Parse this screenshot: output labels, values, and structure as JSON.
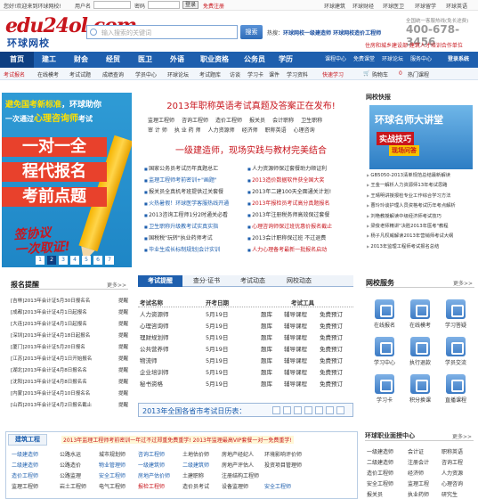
{
  "topbar": {
    "welcome": "您好!欢迎来到环球网校!",
    "username_label": "用户名",
    "password_label": "密码",
    "login": "登录",
    "register": "免费注册",
    "links": [
      "环球建筑",
      "环球财经",
      "环球医卫",
      "环球留学",
      "环球英语"
    ]
  },
  "header": {
    "logo_main": "edu24ol.com",
    "logo_sub": "环球网校",
    "search_placeholder": "输入搜索的关键词",
    "search_button": "搜索",
    "hot_label": "热搜：",
    "hot_terms": "环球网校一级建造师  环球网校造价工程师",
    "phone_label": "全国统一客服热线(免长途费)",
    "phone": "400-678-3456",
    "links": "住房和城乡建设部   建筑人才培训合作单位"
  },
  "nav": {
    "home": "首页",
    "items": [
      "建工",
      "财会",
      "经贸",
      "医卫",
      "外语",
      "职业资格",
      "公务员",
      "学历"
    ],
    "right": [
      "课程中心",
      "免费课堂",
      "环球论坛",
      "服务中心"
    ],
    "login_label": "登录系统"
  },
  "subnav": {
    "items": [
      "考试报名",
      "在线模考",
      "考试试题",
      "成绩查询",
      "学员中心",
      "环球论坛",
      "考试题库",
      "访谈",
      "学习卡",
      "课件",
      "学习资料"
    ],
    "special": "快速学习",
    "cart": "购物车",
    "cart_count": "0",
    "hot_courses": "热门课程"
  },
  "banner": {
    "line1_pre": "避免国",
    "line1_hl": "考新标准",
    "line1_post": "，环球助你",
    "line2_pre": "一次通过",
    "line2_hl": "心理咨询师",
    "line2_post": "考试",
    "big1": "一对一全",
    "big2": "程代报名",
    "big3": "考前点题",
    "sign1": "签协议",
    "sign2": "一次取证!",
    "pages": [
      "1",
      "2",
      "3",
      "4",
      "5",
      "6",
      "7"
    ]
  },
  "reminders": {
    "title": "报名提醒",
    "more": "更多>>",
    "rows": [
      {
        "text": "[吉林]2013年会计证5月30日报名名",
        "tag": "提醒"
      },
      {
        "text": "[成都]2013年会计证4月1日起报名",
        "tag": "提醒"
      },
      {
        "text": "[大连]2013年会计证4月1日起报名",
        "tag": "提醒"
      },
      {
        "text": "[深圳]2013年会计证4月18日起报名",
        "tag": "提醒"
      },
      {
        "text": "[厦门]2013年会计证5月20日报名",
        "tag": "提醒"
      },
      {
        "text": "[江苏]2013年会计证4月1日开始报名",
        "tag": "提醒"
      },
      {
        "text": "[湖北]2013年会计证4月8日报名名",
        "tag": "提醒"
      },
      {
        "text": "[沈阳]2013年会计证4月8日报名名",
        "tag": "提醒"
      },
      {
        "text": "[内蒙]2013年会计证4月10日报名名",
        "tag": "提醒"
      },
      {
        "text": "[山西]2013年会计证4月2日报名截止",
        "tag": "提醒"
      }
    ]
  },
  "center": {
    "headline": "2013年职称英语考试真题及答案正在发布!",
    "grid": [
      [
        "监理工程师",
        "咨询工程师",
        "造价工程师",
        "报关员",
        "会计职称",
        "卫生职称"
      ],
      [
        "审 计 师",
        "执 业 药 师",
        "人力资源师",
        "经济师",
        "职称英语",
        "心理咨询"
      ]
    ],
    "headline2": "一级建造师，现场实践与教材完美结合",
    "left_list": [
      {
        "t": "国家公务员考试历年真题总汇",
        "c": ""
      },
      {
        "t": "监理工程师考前密训+\"画题\"",
        "c": "blue"
      },
      {
        "t": "报关员全真机考班提供过关套餐",
        "c": ""
      },
      {
        "t": "火热暑假！环球医学客服热线开通",
        "c": "blue"
      },
      {
        "t": "2013咨询工程师1分2时通关必看",
        "c": ""
      },
      {
        "t": "卫生职称升级教考试实真实指",
        "c": "blue"
      },
      {
        "t": "国税税\"玩转\"执业药师考试",
        "c": ""
      },
      {
        "t": "毕业生成长标制规划|会计实训",
        "c": "blue"
      }
    ],
    "right_list": [
      {
        "t": "人力资源师保过套餐助力顺证利",
        "c": ""
      },
      {
        "t": "2013造价数据软件获全国大奖",
        "c": "red"
      },
      {
        "t": "2013年二建100天全面通关计划!",
        "c": ""
      },
      {
        "t": "2013年报检员考试高分真题报名",
        "c": "red"
      },
      {
        "t": "2013年注册税务师高效保过套餐",
        "c": ""
      },
      {
        "t": "心理咨询师保过班优惠价报名截止",
        "c": "red"
      },
      {
        "t": "2013会计职称保过班 不过退费",
        "c": ""
      },
      {
        "t": "人力心理备考最新一批报名启动",
        "c": "red"
      }
    ]
  },
  "tabs": {
    "items": [
      "考试提醒",
      "查分·证书",
      "考试动态",
      "网校动态"
    ]
  },
  "exam_table": {
    "headers": [
      "考试名称",
      "开考日期",
      "考试工具"
    ],
    "rows": [
      {
        "name": "人力资源师",
        "date": "5月19日",
        "t1": "题库",
        "t2": "辅导课程",
        "t3": "免费预订"
      },
      {
        "name": "心理咨询师",
        "date": "5月19日",
        "t1": "题库",
        "t2": "辅导课程",
        "t3": "免费预订"
      },
      {
        "name": "理财规划师",
        "date": "5月19日",
        "t1": "题库",
        "t2": "辅导课程",
        "t3": "免费预订"
      },
      {
        "name": "公共营养师",
        "date": "5月19日",
        "t1": "题库",
        "t2": "辅导课程",
        "t3": "免费预订"
      },
      {
        "name": "物流师",
        "date": "5月19日",
        "t1": "题库",
        "t2": "辅导课程",
        "t3": "免费预订"
      },
      {
        "name": "企业培训师",
        "date": "5月19日",
        "t1": "题库",
        "t2": "辅导课程",
        "t3": "免费预订"
      },
      {
        "name": "秘书资格",
        "date": "5月19日",
        "t1": "题库",
        "t2": "辅导课程",
        "t3": "免费预订"
      }
    ],
    "calendar": "2013年全国各省市考试日历表："
  },
  "right_tv": {
    "title": "网校快报",
    "img_t1": "环球名师大讲堂",
    "img_t2": "实战技巧",
    "img_t3": "现场问答",
    "list": [
      "GB5050-2013清单规范总结最新解读",
      "王金一解析人力资源师13年考试思路",
      "王晴明讲授报检专业工作综合学习方法",
      "曹玲玲谈护理人员资格考试历年考点解析",
      "刘艳教授解读中级经济师考试技巧",
      "梁俊老师精讲\"决胜2013年医考\"教程",
      "杨子凡权威解读2013年营销师考试大纲",
      "2013年监理工程师考试报名总结"
    ]
  },
  "services": {
    "title": "网校服务",
    "more": "更多>>",
    "items": [
      "在线报名",
      "在线模考",
      "学习答疑",
      "学习中心",
      "执行退款",
      "学员交流",
      "学习卡",
      "积分换课",
      "直播课程"
    ]
  },
  "bottom_left": {
    "category": "建筑工程",
    "promo": "2013年监理工程师考前密训一年过不过郑重免费重学!  2013年监理最高VIP套餐一对一免费重学!",
    "rows": [
      [
        {
          "t": "一级建造师",
          "c": "blue"
        },
        {
          "t": "公路水运",
          "c": ""
        },
        {
          "t": "城市规划师",
          "c": ""
        },
        {
          "t": "咨询工程师",
          "c": "blue"
        },
        {
          "t": "土地估价师",
          "c": ""
        },
        {
          "t": "房地产经纪人",
          "c": ""
        },
        {
          "t": "环境影响评价师",
          "c": ""
        }
      ],
      [
        {
          "t": "二级建造师",
          "c": "blue"
        },
        {
          "t": "公路造价",
          "c": ""
        },
        {
          "t": "物业管理师",
          "c": "blue"
        },
        {
          "t": "一级建筑师",
          "c": "blue"
        },
        {
          "t": "二级建筑师",
          "c": "blue"
        },
        {
          "t": "房地产评估人",
          "c": ""
        },
        {
          "t": "投资项目管理师",
          "c": ""
        }
      ],
      [
        {
          "t": "造价工程师",
          "c": "blue"
        },
        {
          "t": "公路监理",
          "c": ""
        },
        {
          "t": "安全工程师",
          "c": "blue"
        },
        {
          "t": "房地产估价师",
          "c": "blue"
        },
        {
          "t": "土建职称",
          "c": ""
        },
        {
          "t": "注册结构工程师",
          "c": ""
        },
        {
          "t": "",
          "c": ""
        }
      ],
      [
        {
          "t": "监理工程师",
          "c": ""
        },
        {
          "t": "岩土工程师",
          "c": ""
        },
        {
          "t": "电气工程师",
          "c": ""
        },
        {
          "t": "报检工程师",
          "c": "red"
        },
        {
          "t": "造价员考试",
          "c": ""
        },
        {
          "t": "设备监理师",
          "c": ""
        },
        {
          "t": "安全工程师",
          "c": ""
        }
      ]
    ]
  },
  "bottom_right": {
    "title": "环球职业面授中心",
    "more": "更多>>",
    "rows": [
      [
        "一级建造师",
        "会计证",
        "职称英语"
      ],
      [
        "二级建造师",
        "注册会计",
        "咨询工程"
      ],
      [
        "造价工程师",
        "经济师",
        "人力资源"
      ],
      [
        "安全工程师",
        "监理工程",
        "心理咨询"
      ],
      [
        "报关员",
        "执业药师",
        "研究生"
      ]
    ]
  }
}
